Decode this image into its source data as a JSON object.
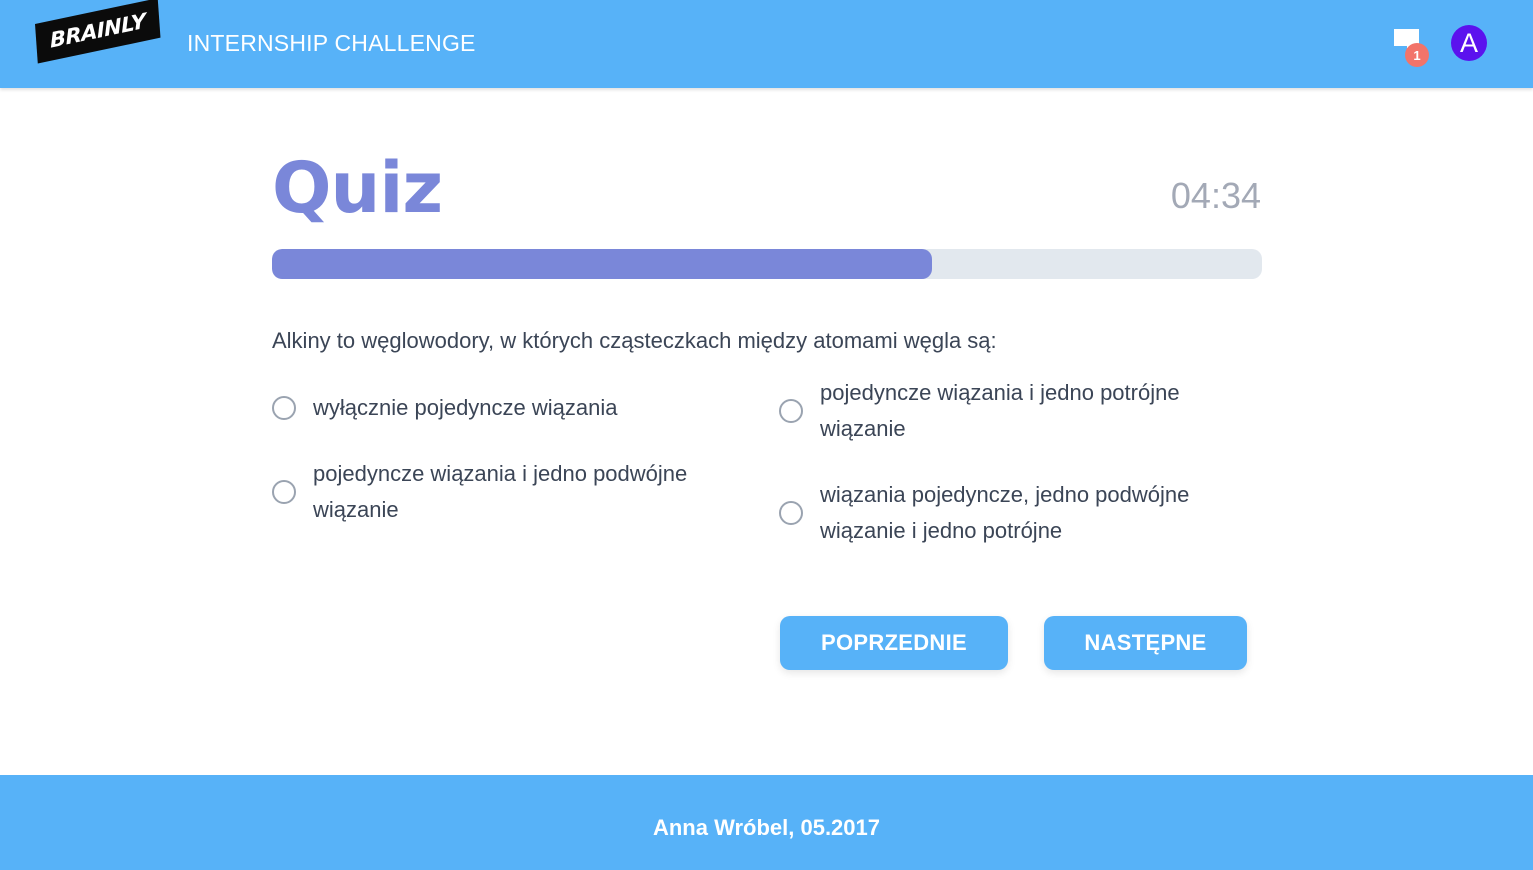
{
  "header": {
    "logo_text": "BRAINLY",
    "app_title": "INTERNSHIP CHALLENGE",
    "messages_badge": "1",
    "avatar_letter": "A",
    "colors": {
      "bar": "#57b2f8",
      "badge": "#f2746a",
      "avatar": "#5b12ee"
    }
  },
  "quiz": {
    "title": "Quiz",
    "timer": "04:34",
    "progress_fraction": 0.667,
    "question": "Alkiny to węglowodory, w których cząsteczkach między atomami węgla są:",
    "options": [
      {
        "label": "wyłącznie pojedyncze wiązania",
        "selected": false
      },
      {
        "label": "pojedyncze wiązania i jedno potrójne wiązanie",
        "selected": false
      },
      {
        "label": "pojedyncze wiązania i jedno podwójne wiązanie",
        "selected": false
      },
      {
        "label": "wiązania pojedyncze, jedno podwójne wiązanie i jedno potrójne",
        "selected": false
      }
    ],
    "prev_label": "POPRZEDNIE",
    "next_label": "NASTĘPNE",
    "accent_color": "#7a87d9"
  },
  "footer": {
    "text": "Anna Wróbel, 05.2017"
  }
}
